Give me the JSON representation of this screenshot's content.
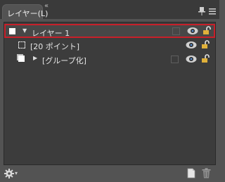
{
  "panel": {
    "tab_label": "レイヤー(L)",
    "tab_close": "«"
  },
  "layers": [
    {
      "name": "レイヤー 1",
      "selected": true,
      "expanded": true,
      "visible": true,
      "locked": false
    },
    {
      "name": "[20 ポイント]",
      "selected": false,
      "visible": true,
      "locked": false
    },
    {
      "name": "[グループ化]",
      "selected": false,
      "collapsed": true,
      "visible": true,
      "locked": false
    }
  ],
  "icons": {
    "tab_pin": "pin-icon",
    "panel_menu": "panel-menu-icon",
    "visibility": "eye-icon",
    "lock": "unlocked-padlock-icon",
    "options": "gear-icon",
    "new_layer": "new-layer-icon",
    "delete": "trash-icon"
  },
  "colors": {
    "selection_border": "#c8202a",
    "lock_color": "#e0b13a",
    "eye_color": "#d0d0d0"
  }
}
